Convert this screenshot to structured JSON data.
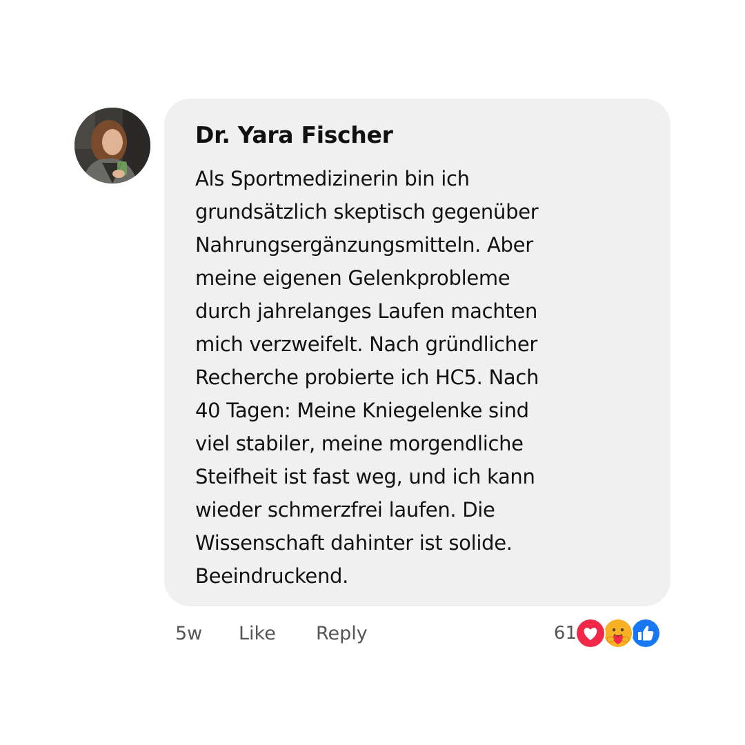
{
  "comment": {
    "author": "Dr. Yara Fischer",
    "lines": [
      "Als Sportmedizinerin bin ich",
      "grundsätzlich skeptisch gegenüber",
      "Nahrungsergänzungsmitteln. Aber",
      "meine eigenen Gelenkprobleme",
      "durch jahrelanges Laufen machten",
      "mich verzweifelt. Nach gründlicher",
      "Recherche probierte ich HC5. Nach",
      "40 Tagen: Meine Kniegelenke sind",
      "viel stabiler, meine morgendliche",
      "Steifheit ist fast weg, und ich kann",
      "wieder schmerzfrei laufen. Die",
      "Wissenschaft dahinter ist solide.",
      "Beeindruckend."
    ]
  },
  "actions": {
    "time": "5w",
    "like_label": "Like",
    "reply_label": "Reply"
  },
  "reactions": {
    "count": "61",
    "icons": [
      "heart-reaction-icon",
      "care-reaction-icon",
      "like-reaction-icon"
    ]
  },
  "colors": {
    "bubble": "#f0f0f0",
    "text": "#111111",
    "muted": "#555555",
    "heart": "#f0284a",
    "like": "#1877f2",
    "care": "#f7b125"
  }
}
